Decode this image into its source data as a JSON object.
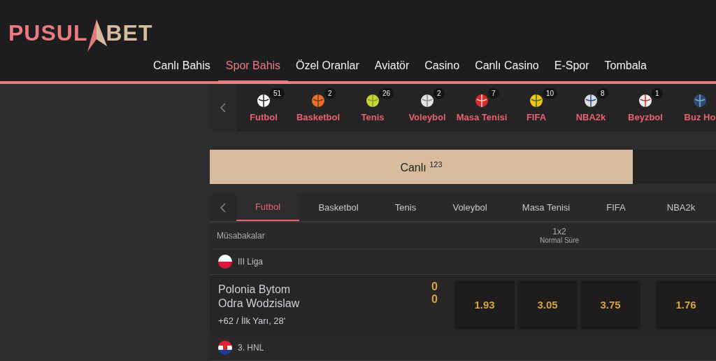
{
  "logo": {
    "left": "PUSUL",
    "right": "BET"
  },
  "nav": [
    {
      "label": "Canlı Bahis",
      "selected": false
    },
    {
      "label": "Spor Bahis",
      "selected": true
    },
    {
      "label": "Özel Oranlar",
      "selected": false
    },
    {
      "label": "Aviatör",
      "selected": false
    },
    {
      "label": "Casino",
      "selected": false
    },
    {
      "label": "Canlı Casino",
      "selected": false
    },
    {
      "label": "E-Spor",
      "selected": false
    },
    {
      "label": "Tombala",
      "selected": false
    }
  ],
  "sports": [
    {
      "kind": "soccer",
      "label": "Futbol",
      "count": "51"
    },
    {
      "kind": "basketball",
      "label": "Basketbol",
      "count": "2"
    },
    {
      "kind": "tennis",
      "label": "Tenis",
      "count": "26"
    },
    {
      "kind": "volleyball",
      "label": "Voleybol",
      "count": "2"
    },
    {
      "kind": "pingpong",
      "label": "Masa Tenisi",
      "count": "7"
    },
    {
      "kind": "fifa",
      "label": "FIFA",
      "count": "10"
    },
    {
      "kind": "nba",
      "label": "NBA2k",
      "count": "8"
    },
    {
      "kind": "baseball",
      "label": "Beyzbol",
      "count": "1"
    },
    {
      "kind": "hockey",
      "label": "Buz Ho"
    }
  ],
  "live_bar": {
    "label": "Canlı",
    "count": "123"
  },
  "tabs": [
    {
      "label": "Futbol",
      "selected": true
    },
    {
      "label": "Basketbol",
      "selected": false
    },
    {
      "label": "Tenis",
      "selected": false
    },
    {
      "label": "Voleybol",
      "selected": false
    },
    {
      "label": "Masa Tenisi",
      "selected": false
    },
    {
      "label": "FIFA",
      "selected": false
    },
    {
      "label": "NBA2k",
      "selected": false
    }
  ],
  "table_header": {
    "column_1": "Müsabakalar",
    "market": "1x2",
    "market_sub": "Normal Süre"
  },
  "leagues": [
    {
      "kind": "poland",
      "name": "III Liga",
      "matches": [
        {
          "home": "Polonia Bytom",
          "away": "Odra Wodzislaw",
          "home_score": "0",
          "away_score": "0",
          "info": "+62 / İlk Yarı, 28'",
          "odds": [
            "1.93",
            "3.05",
            "3.75"
          ],
          "extra_odds": [
            "1.76"
          ]
        }
      ]
    },
    {
      "kind": "croatia",
      "name": "3. HNL"
    }
  ]
}
